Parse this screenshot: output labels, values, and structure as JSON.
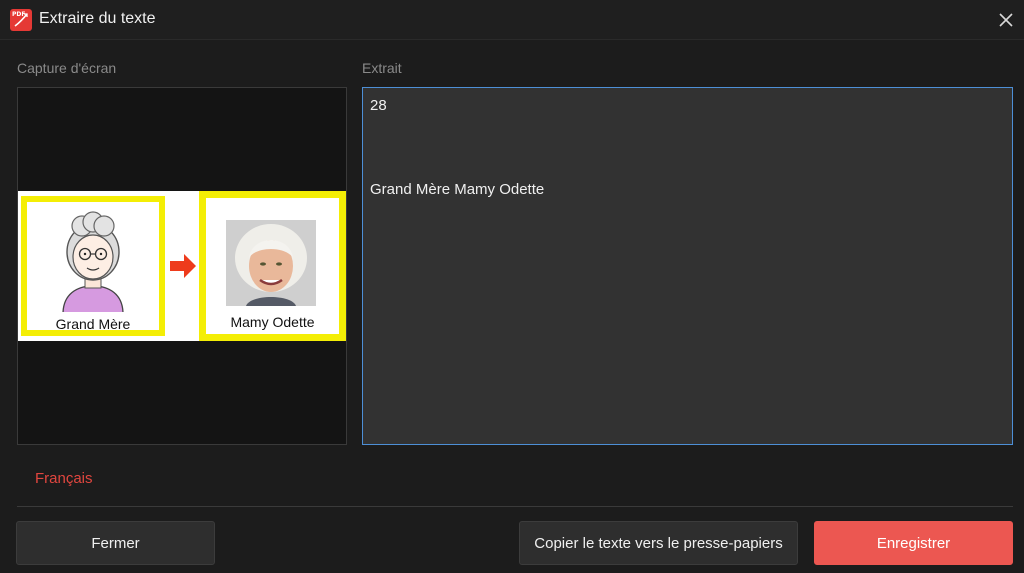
{
  "window": {
    "title": "Extraire du texte",
    "app_icon": "pdf-app-icon",
    "close_icon": "close-icon"
  },
  "capture": {
    "label": "Capture d'écran",
    "image": {
      "card1_text": "Grand Mère",
      "card2_text": "Mamy Odette",
      "arrow_icon": "arrow-right-icon"
    }
  },
  "extract": {
    "label": "Extrait",
    "lines": [
      "28",
      "Grand Mère Mamy Odette"
    ]
  },
  "language": "Français",
  "buttons": {
    "close": "Fermer",
    "copy": "Copier le texte vers le presse-papiers",
    "save": "Enregistrer"
  },
  "colors": {
    "accent": "#ec5751",
    "focus_border": "#4d8fd6",
    "highlight_yellow": "#f4ee05"
  }
}
